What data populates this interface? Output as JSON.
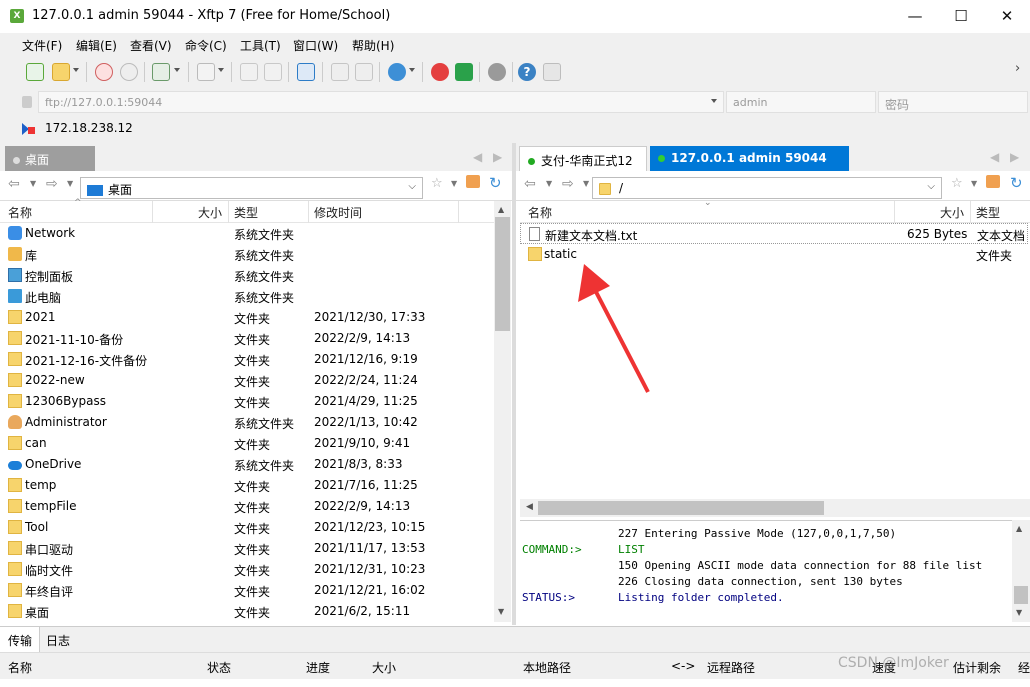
{
  "window": {
    "title": "127.0.0.1 admin 59044 - Xftp 7 (Free for Home/School)",
    "minimize_glyph": "—",
    "maximize_glyph": "☐",
    "close_glyph": "✕"
  },
  "menu": [
    "文件(F)",
    "编辑(E)",
    "查看(V)",
    "命令(C)",
    "工具(T)",
    "窗口(W)",
    "帮助(H)"
  ],
  "address": {
    "url": "ftp://127.0.0.1:59044",
    "user_placeholder": "admin",
    "password_placeholder": "密码"
  },
  "session": {
    "host": "172.18.238.12"
  },
  "left_pane": {
    "tab": "桌面",
    "path": "桌面",
    "columns": [
      "名称",
      "大小",
      "类型",
      "修改时间"
    ],
    "rows": [
      {
        "name": "Network",
        "type": "系统文件夹",
        "modified": "",
        "icon": "network-icon"
      },
      {
        "name": "库",
        "type": "系统文件夹",
        "modified": "",
        "icon": "library-icon"
      },
      {
        "name": "控制面板",
        "type": "系统文件夹",
        "modified": "",
        "icon": "control-panel-icon"
      },
      {
        "name": "此电脑",
        "type": "系统文件夹",
        "modified": "",
        "icon": "computer-icon"
      },
      {
        "name": "2021",
        "type": "文件夹",
        "modified": "2021/12/30, 17:33",
        "icon": "folder-icon"
      },
      {
        "name": "2021-11-10-备份",
        "type": "文件夹",
        "modified": "2022/2/9, 14:13",
        "icon": "folder-icon"
      },
      {
        "name": "2021-12-16-文件备份",
        "type": "文件夹",
        "modified": "2021/12/16, 9:19",
        "icon": "folder-icon"
      },
      {
        "name": "2022-new",
        "type": "文件夹",
        "modified": "2022/2/24, 11:24",
        "icon": "folder-icon"
      },
      {
        "name": "12306Bypass",
        "type": "文件夹",
        "modified": "2021/4/29, 11:25",
        "icon": "folder-icon"
      },
      {
        "name": "Administrator",
        "type": "系统文件夹",
        "modified": "2022/1/13, 10:42",
        "icon": "user-icon"
      },
      {
        "name": "can",
        "type": "文件夹",
        "modified": "2021/9/10, 9:41",
        "icon": "folder-icon"
      },
      {
        "name": "OneDrive",
        "type": "系统文件夹",
        "modified": "2021/8/3, 8:33",
        "icon": "cloud-icon"
      },
      {
        "name": "temp",
        "type": "文件夹",
        "modified": "2021/7/16, 11:25",
        "icon": "folder-icon"
      },
      {
        "name": "tempFile",
        "type": "文件夹",
        "modified": "2022/2/9, 14:13",
        "icon": "folder-icon"
      },
      {
        "name": "Tool",
        "type": "文件夹",
        "modified": "2021/12/23, 10:15",
        "icon": "folder-icon"
      },
      {
        "name": "串口驱动",
        "type": "文件夹",
        "modified": "2021/11/17, 13:53",
        "icon": "folder-icon"
      },
      {
        "name": "临时文件",
        "type": "文件夹",
        "modified": "2021/12/31, 10:23",
        "icon": "folder-icon"
      },
      {
        "name": "年终自评",
        "type": "文件夹",
        "modified": "2021/12/21, 16:02",
        "icon": "folder-icon"
      },
      {
        "name": "桌面",
        "type": "文件夹",
        "modified": "2021/6/2, 15:11",
        "icon": "folder-icon"
      }
    ]
  },
  "right_pane": {
    "tabs": [
      "支付-华南正式12",
      "127.0.0.1 admin 59044"
    ],
    "path": "/",
    "columns": [
      "名称",
      "大小",
      "类型"
    ],
    "rows": [
      {
        "name": "新建文本文档.txt",
        "size": "625 Bytes",
        "type": "文本文档",
        "icon": "text-file-icon"
      },
      {
        "name": "static",
        "size": "",
        "type": "文件夹",
        "icon": "folder-icon"
      }
    ]
  },
  "log": [
    {
      "label": "",
      "text": "227 Entering Passive Mode (127,0,0,1,7,50)",
      "color": "#000000"
    },
    {
      "label": "COMMAND:>",
      "text": "LIST",
      "color": "#008000"
    },
    {
      "label": "",
      "text": "150 Opening ASCII mode data connection for  88 file list",
      "color": "#000000"
    },
    {
      "label": "",
      "text": "226 Closing data connection, sent 130 bytes",
      "color": "#000000"
    },
    {
      "label": "STATUS:>",
      "text": "Listing folder completed.",
      "color": "#000080"
    }
  ],
  "bottom_tabs": [
    "传输",
    "日志"
  ],
  "transfer_columns": [
    "名称",
    "状态",
    "进度",
    "大小",
    "本地路径",
    "<->",
    "远程路径",
    "速度",
    "估计剩余",
    "经"
  ],
  "watermark": "CSDN @ImJoker",
  "colors": {
    "active_tab": "#0078d7",
    "arrow": "#ee3333",
    "green_dot": "#22aa22"
  }
}
